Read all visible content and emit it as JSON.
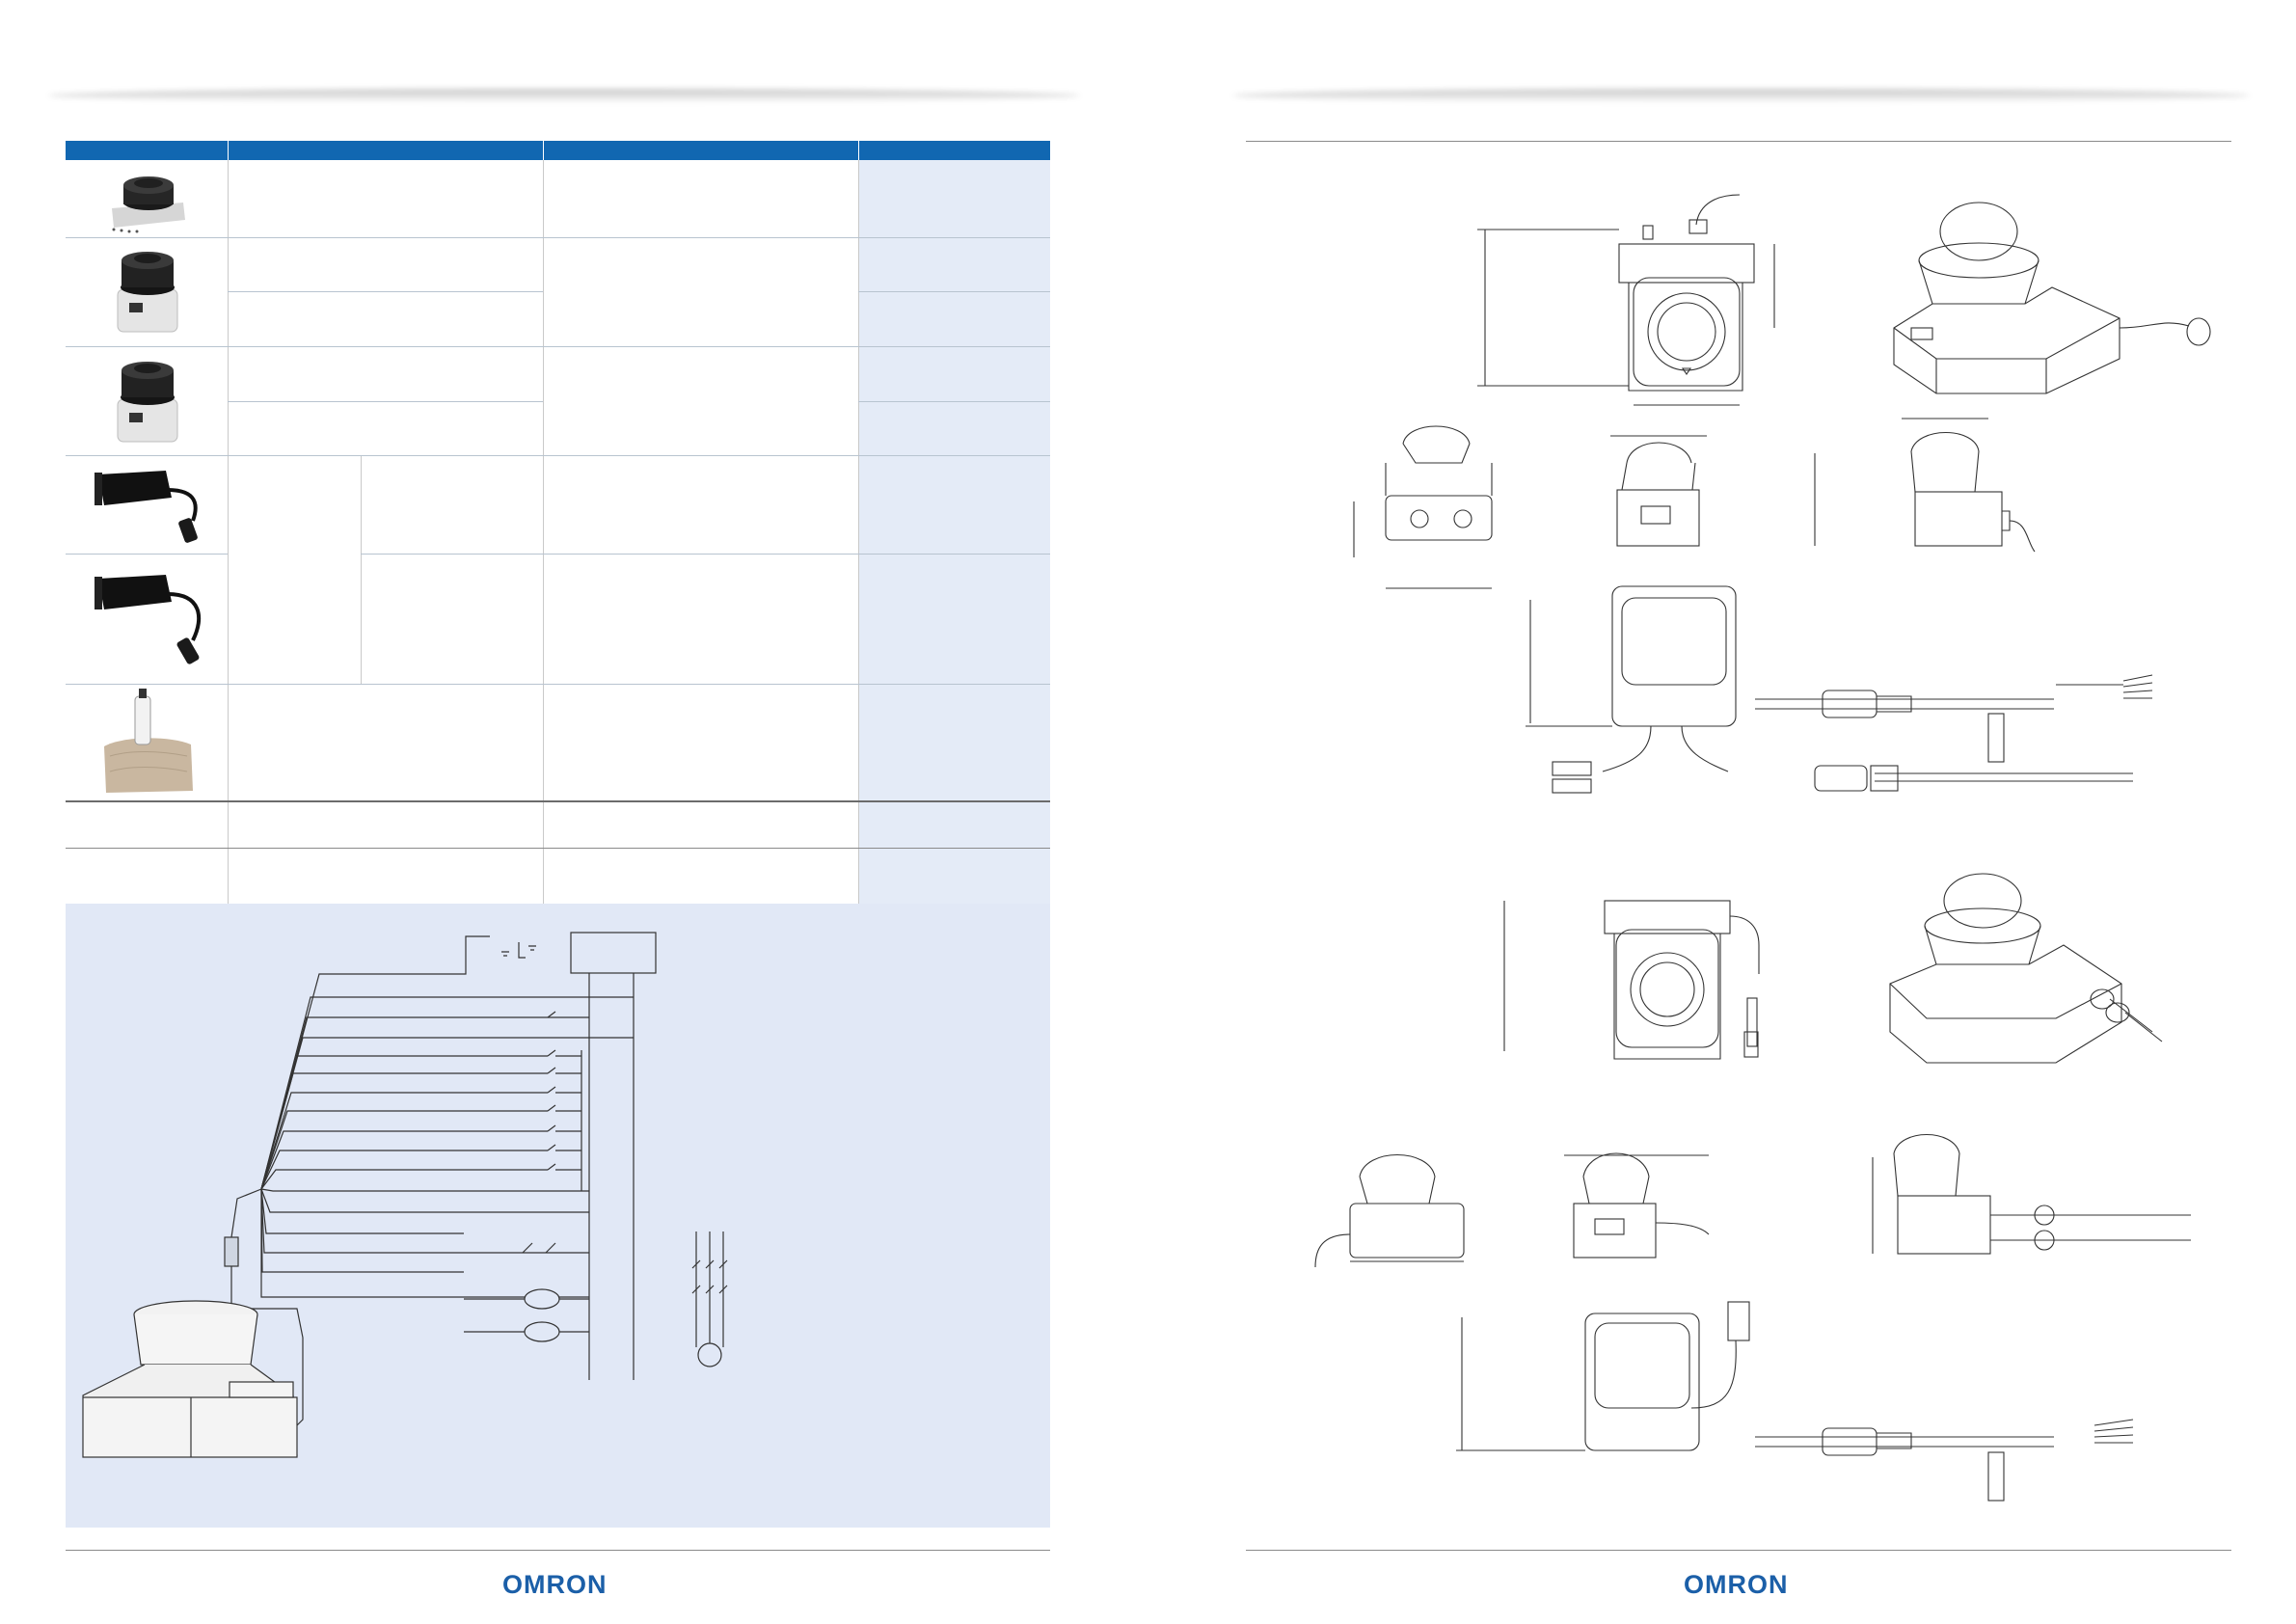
{
  "left_page": {
    "table": {
      "headers": [
        "",
        "",
        "",
        ""
      ],
      "rows": [
        {
          "image": "scanner-mounting-plate-photo",
          "description": "",
          "spec": "",
          "order": ""
        },
        {
          "image": "scanner-photo-1",
          "description": "",
          "spec": "",
          "order": ""
        },
        {
          "image": "scanner-photo-2",
          "description": "",
          "spec": "",
          "order": ""
        },
        {
          "image": "connector-bracket-photo-1",
          "description": "",
          "spec": "",
          "order": ""
        },
        {
          "image": "connector-bracket-photo-2",
          "description": "",
          "spec": "",
          "order": ""
        },
        {
          "image": "cleaning-kit-photo",
          "description": "",
          "spec": "",
          "order": ""
        }
      ]
    },
    "section_title": "",
    "wiring_title": "",
    "logo": "OMRON"
  },
  "right_page": {
    "section_title": "",
    "logo": "OMRON"
  },
  "colors": {
    "header_blue": "#1167b1",
    "panel_bg": "#e1e8f6",
    "order_column_bg": "#e4ebf7",
    "logo_blue": "#1b5fa8"
  }
}
